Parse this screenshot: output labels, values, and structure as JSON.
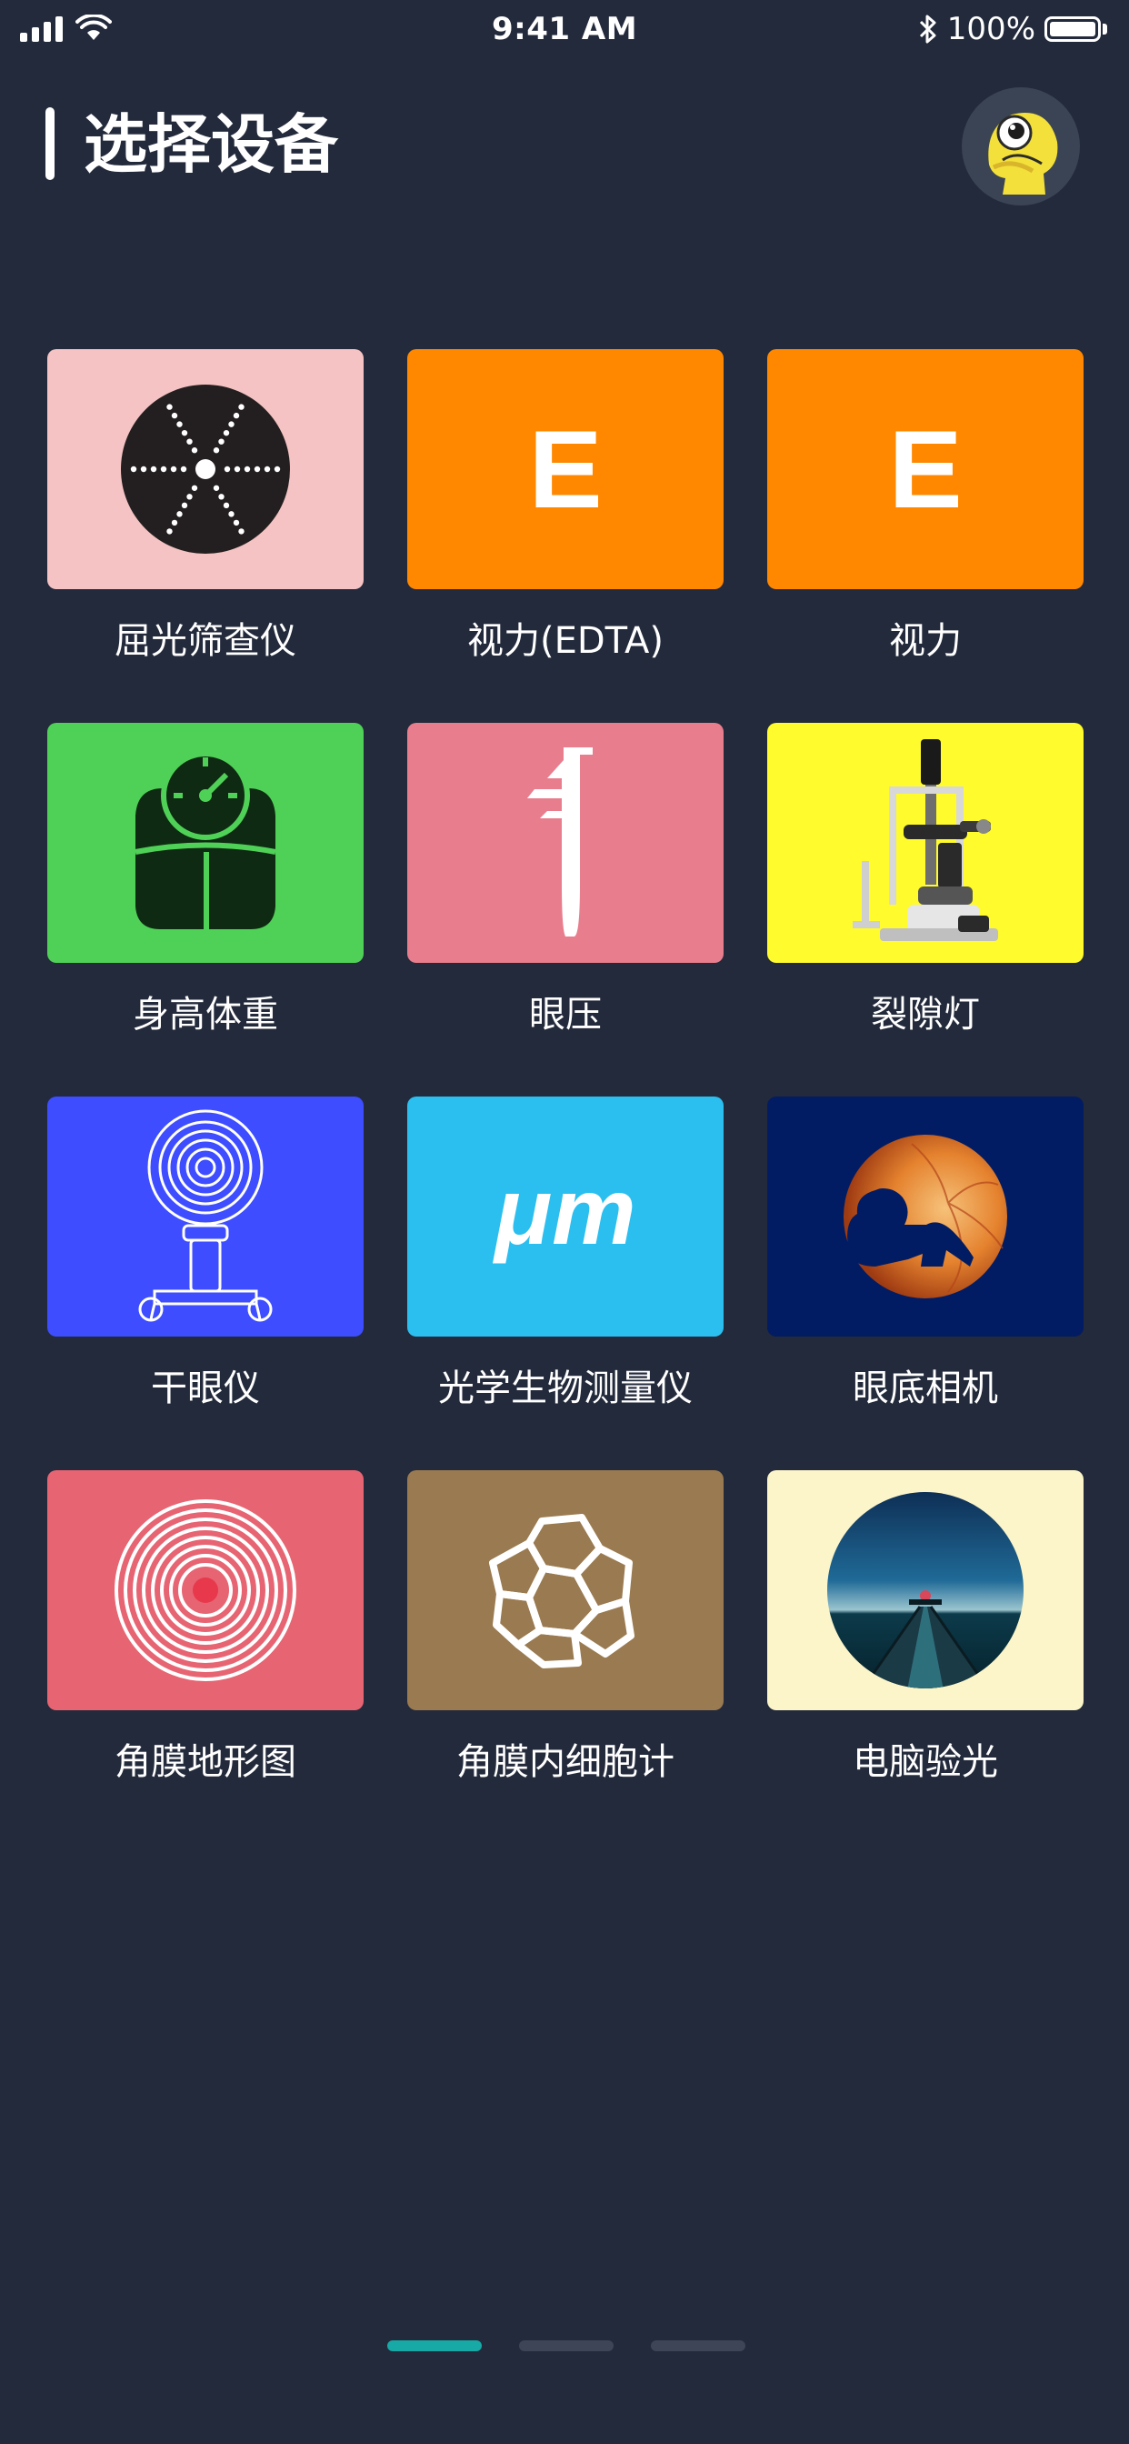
{
  "status_bar": {
    "time": "9:41 AM",
    "battery_text": "100%",
    "battery_level": 1.0,
    "icons": [
      "signal-icon",
      "wifi-icon",
      "bluetooth-icon",
      "battery-icon"
    ]
  },
  "header": {
    "title": "选择设备",
    "avatar_icon": "cartoon-avatar-icon"
  },
  "devices": [
    {
      "label": "屈光筛查仪",
      "icon": "refraction-screener-icon",
      "bg": "#f5c3c3"
    },
    {
      "label": "视力(EDTA)",
      "icon": "eye-chart-e-icon",
      "bg": "#ff8800"
    },
    {
      "label": "视力",
      "icon": "eye-chart-e-icon",
      "bg": "#ff8800"
    },
    {
      "label": "身高体重",
      "icon": "scale-icon",
      "bg": "#4fd157"
    },
    {
      "label": "眼压",
      "icon": "tonometer-icon",
      "bg": "#e87e8d"
    },
    {
      "label": "裂隙灯",
      "icon": "slit-lamp-icon",
      "bg": "#fffb2c"
    },
    {
      "label": "干眼仪",
      "icon": "dry-eye-device-icon",
      "bg": "#3d4dff"
    },
    {
      "label": "光学生物测量仪",
      "icon": "micrometer-icon",
      "bg": "#2bbff0"
    },
    {
      "label": "眼底相机",
      "icon": "fundus-camera-icon",
      "bg": "#021c63"
    },
    {
      "label": "角膜地形图",
      "icon": "corneal-topography-icon",
      "bg": "#e76472"
    },
    {
      "label": "角膜内细胞计",
      "icon": "endothelial-cells-icon",
      "bg": "#9a7a50"
    },
    {
      "label": "电脑验光",
      "icon": "auto-refractor-icon",
      "bg": "#fbf5c9"
    }
  ],
  "devices_extra": {
    "e_letter": "E",
    "mu_text": "μm"
  },
  "pager": {
    "pages": 3,
    "active": 0,
    "active_color": "#17a9a6"
  }
}
